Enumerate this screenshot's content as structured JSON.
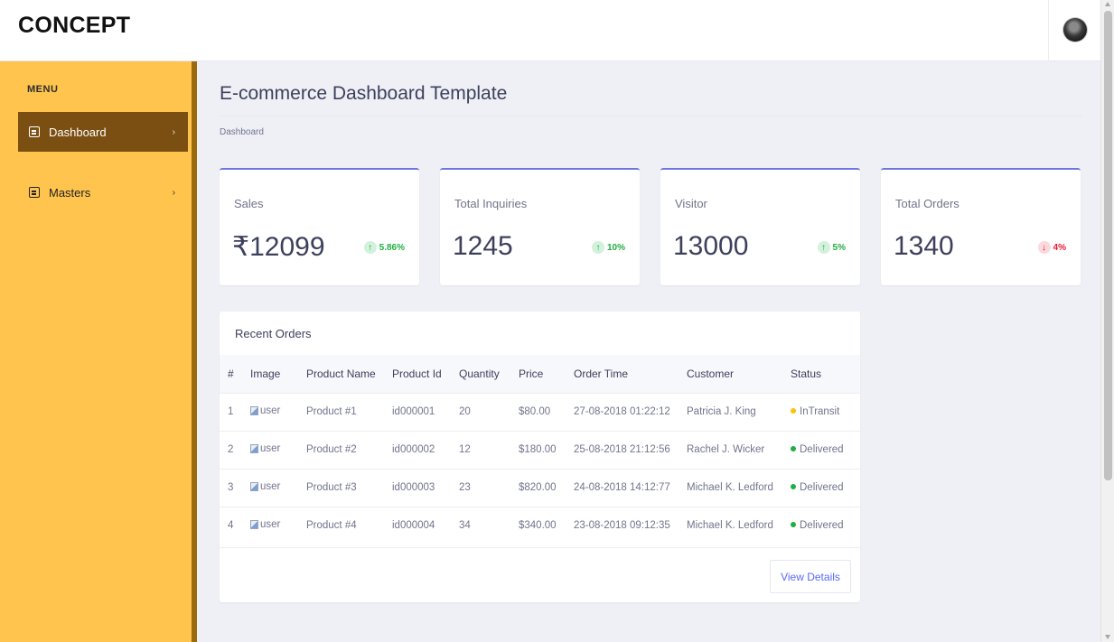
{
  "app": {
    "brand": "CONCEPT"
  },
  "header": {
    "avatar_icon": "user-avatar-icon"
  },
  "sidebar": {
    "menu_title": "MENU",
    "items": [
      {
        "label": "Dashboard",
        "icon": "dashboard-icon",
        "active": true
      },
      {
        "label": "Masters",
        "icon": "masters-icon",
        "active": false
      }
    ],
    "colors": {
      "background": "#fec44e",
      "active": "#7a4f11",
      "edge": "#9b6a0f"
    }
  },
  "page": {
    "title": "E-commerce Dashboard Template",
    "breadcrumb": "Dashboard"
  },
  "cards": [
    {
      "label": "Sales",
      "value": "₹12099",
      "delta": "5.86%",
      "direction": "up"
    },
    {
      "label": "Total Inquiries",
      "value": "1245",
      "delta": "10%",
      "direction": "up"
    },
    {
      "label": "Visitor",
      "value": "13000",
      "delta": "5%",
      "direction": "up"
    },
    {
      "label": "Total Orders",
      "value": "1340",
      "delta": "4%",
      "direction": "down"
    }
  ],
  "orders": {
    "title": "Recent Orders",
    "columns": [
      "#",
      "Image",
      "Product Name",
      "Product Id",
      "Quantity",
      "Price",
      "Order Time",
      "Customer",
      "Status"
    ],
    "rows": [
      {
        "num": "1",
        "image_alt": "user",
        "product": "Product #1",
        "product_id": "id000001",
        "quantity": "20",
        "price": "$80.00",
        "time": "27-08-2018 01:22:12",
        "customer": "Patricia J. King",
        "status": "InTransit",
        "status_color": "#ffc108"
      },
      {
        "num": "2",
        "image_alt": "user",
        "product": "Product #2",
        "product_id": "id000002",
        "quantity": "12",
        "price": "$180.00",
        "time": "25-08-2018 21:12:56",
        "customer": "Rachel J. Wicker",
        "status": "Delivered",
        "status_color": "#21ae41"
      },
      {
        "num": "3",
        "image_alt": "user",
        "product": "Product #3",
        "product_id": "id000003",
        "quantity": "23",
        "price": "$820.00",
        "time": "24-08-2018 14:12:77",
        "customer": "Michael K. Ledford",
        "status": "Delivered",
        "status_color": "#21ae41"
      },
      {
        "num": "4",
        "image_alt": "user",
        "product": "Product #4",
        "product_id": "id000004",
        "quantity": "34",
        "price": "$340.00",
        "time": "23-08-2018 09:12:35",
        "customer": "Michael K. Ledford",
        "status": "Delivered",
        "status_color": "#21ae41"
      }
    ],
    "view_details_label": "View Details"
  }
}
